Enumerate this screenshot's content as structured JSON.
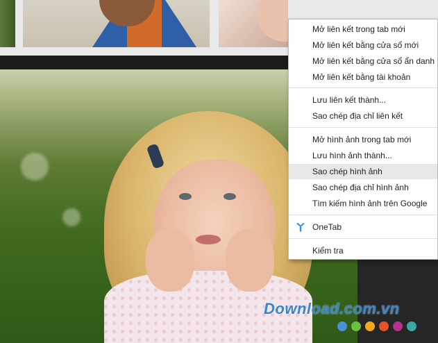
{
  "context_menu": {
    "items": [
      {
        "label": "Mở liên kết trong tab mới"
      },
      {
        "label": "Mở liên kết bằng cửa sổ mới"
      },
      {
        "label": "Mở liên kết bằng cửa sổ ẩn danh"
      },
      {
        "label": "Mở liên kết bằng tài khoản"
      },
      {
        "label": "Lưu liên kết thành..."
      },
      {
        "label": "Sao chép địa chỉ liên kết"
      },
      {
        "label": "Mở hình ảnh trong tab mới"
      },
      {
        "label": "Lưu hình ảnh thành..."
      },
      {
        "label": "Sao chép hình ảnh",
        "highlighted": true
      },
      {
        "label": "Sao chép địa chỉ hình ảnh"
      },
      {
        "label": "Tìm kiếm hình ảnh trên Google"
      },
      {
        "label": "OneTab",
        "icon": "onetab-icon"
      },
      {
        "label": "Kiểm tra"
      }
    ]
  },
  "watermark": {
    "text": "Download.com.vn",
    "dot_colors": [
      "#4a90d9",
      "#6cbf3f",
      "#f2a91e",
      "#e8512e",
      "#b5338a",
      "#3fa6a6"
    ]
  },
  "colors": {
    "menu_highlight": "#e8e8e8",
    "onetab_accent": "#2c8fe0"
  }
}
